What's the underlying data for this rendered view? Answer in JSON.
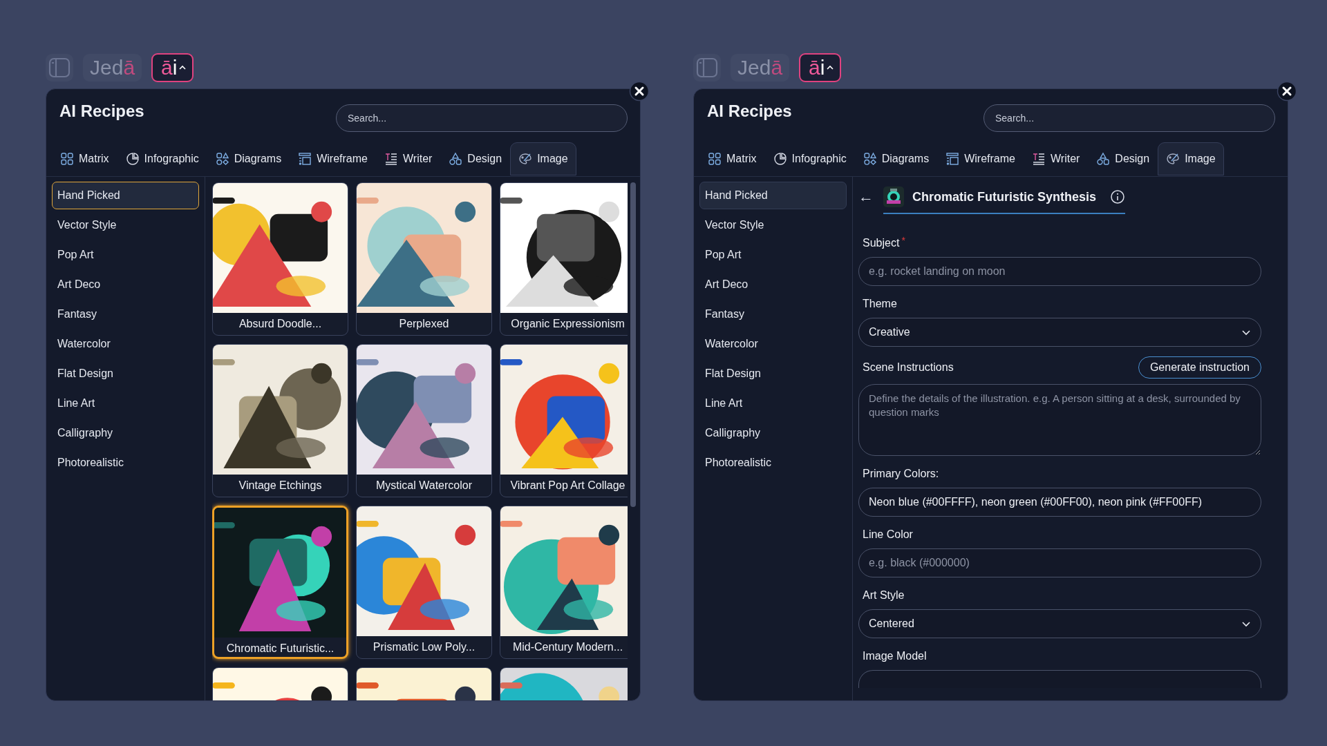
{
  "panels": [
    {
      "topbar": {
        "logo_parts": [
          "Jed",
          "ā"
        ],
        "ai_parts": [
          "ā",
          "i"
        ]
      },
      "title": "AI Recipes",
      "search": {
        "placeholder": "Search..."
      },
      "tabs": [
        {
          "label": "Matrix",
          "selected": false
        },
        {
          "label": "Infographic",
          "selected": false
        },
        {
          "label": "Diagrams",
          "selected": false
        },
        {
          "label": "Wireframe",
          "selected": false
        },
        {
          "label": "Writer",
          "selected": false
        },
        {
          "label": "Design",
          "selected": false
        },
        {
          "label": "Image",
          "selected": true
        }
      ],
      "sidebar": [
        {
          "label": "Hand Picked",
          "selected": true,
          "focused": true
        },
        {
          "label": "Vector Style",
          "selected": false,
          "focused": false
        },
        {
          "label": "Pop Art",
          "selected": false,
          "focused": false
        },
        {
          "label": "Art Deco",
          "selected": false,
          "focused": false
        },
        {
          "label": "Fantasy",
          "selected": false,
          "focused": false
        },
        {
          "label": "Watercolor",
          "selected": false,
          "focused": false
        },
        {
          "label": "Flat Design",
          "selected": false,
          "focused": false
        },
        {
          "label": "Line Art",
          "selected": false,
          "focused": false
        },
        {
          "label": "Calligraphy",
          "selected": false,
          "focused": false
        },
        {
          "label": "Photorealistic",
          "selected": false,
          "focused": false
        }
      ],
      "cards": [
        {
          "kind": "picture",
          "label": "Absurd Doodle...",
          "selected": false
        },
        {
          "kind": "picture",
          "label": "Perplexed",
          "selected": false
        },
        {
          "kind": "picture",
          "label": "Organic Expressionism",
          "selected": false
        },
        {
          "kind": "picture",
          "label": "Vintage Etchings",
          "selected": false
        },
        {
          "kind": "picture",
          "label": "Mystical Watercolor",
          "selected": false
        },
        {
          "kind": "picture",
          "label": "Vibrant Pop Art Collage",
          "selected": false
        },
        {
          "kind": "picture",
          "label": "Chromatic Futuristic...",
          "selected": true
        },
        {
          "kind": "picture",
          "label": "Prismatic Low Poly...",
          "selected": false
        },
        {
          "kind": "picture",
          "label": "Mid-Century Modern...",
          "selected": false
        },
        {
          "kind": "picture",
          "selected": false
        },
        {
          "kind": "picture",
          "selected": false
        },
        {
          "kind": "picture",
          "selected": false
        }
      ]
    },
    {
      "topbar": {
        "logo_parts": [
          "Jed",
          "ā"
        ],
        "ai_parts": [
          "ā",
          "i"
        ]
      },
      "title": "AI Recipes",
      "search": {
        "placeholder": "Search..."
      },
      "tabs": [
        {
          "label": "Matrix",
          "selected": false
        },
        {
          "label": "Infographic",
          "selected": false
        },
        {
          "label": "Diagrams",
          "selected": false
        },
        {
          "label": "Wireframe",
          "selected": false
        },
        {
          "label": "Writer",
          "selected": false
        },
        {
          "label": "Design",
          "selected": false
        },
        {
          "label": "Image",
          "selected": true
        }
      ],
      "sidebar": [
        {
          "label": "Hand Picked",
          "selected": true,
          "focused": false
        },
        {
          "label": "Vector Style",
          "selected": false,
          "focused": false
        },
        {
          "label": "Pop Art",
          "selected": false,
          "focused": false
        },
        {
          "label": "Art Deco",
          "selected": false,
          "focused": false
        },
        {
          "label": "Fantasy",
          "selected": false,
          "focused": false
        },
        {
          "label": "Watercolor",
          "selected": false,
          "focused": false
        },
        {
          "label": "Flat Design",
          "selected": false,
          "focused": false
        },
        {
          "label": "Line Art",
          "selected": false,
          "focused": false
        },
        {
          "label": "Calligraphy",
          "selected": false,
          "focused": false
        },
        {
          "label": "Photorealistic",
          "selected": false,
          "focused": false
        }
      ],
      "form": {
        "back": "←",
        "title": "Chromatic Futuristic Synthesis",
        "fields": [
          {
            "kind": "input",
            "label": "Subject",
            "required_mark": "*",
            "placeholder": "e.g. rocket landing on moon"
          },
          {
            "kind": "select",
            "label": "Theme",
            "value": "Creative"
          },
          {
            "kind": "textarea",
            "label": "Scene Instructions",
            "action": "Generate instruction",
            "placeholder": "Define the details of the illustration. e.g. A person sitting at a desk, surrounded by question marks"
          },
          {
            "kind": "input",
            "label": "Primary Colors:",
            "value": "Neon blue (#00FFFF), neon green (#00FF00), neon pink (#FF00FF)"
          },
          {
            "kind": "input",
            "label": "Line Color",
            "placeholder": "e.g. black (#000000)"
          },
          {
            "kind": "select",
            "label": "Art Style",
            "value": "Centered"
          },
          {
            "kind": "partial",
            "label": "Image Model"
          }
        ]
      }
    }
  ]
}
